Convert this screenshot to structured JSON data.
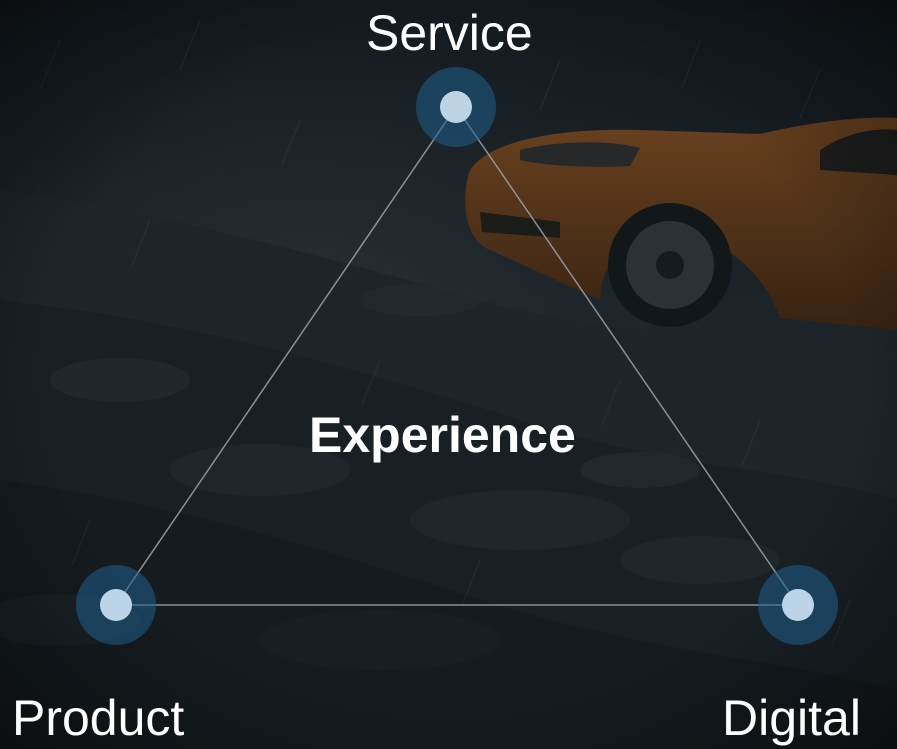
{
  "diagram": {
    "center_label": "Experience",
    "nodes": [
      {
        "id": "service",
        "label": "Service"
      },
      {
        "id": "product",
        "label": "Product"
      },
      {
        "id": "digital",
        "label": "Digital"
      }
    ]
  },
  "colors": {
    "background": "#1b2228",
    "edge": "#9aa4ad",
    "node_halo": "#1f5f8c",
    "node_core": "#bcd4e6",
    "text": "#ffffff",
    "car_body": "#7a4216"
  },
  "background_image": {
    "icon": "car-on-rocky-terrain-photo"
  }
}
